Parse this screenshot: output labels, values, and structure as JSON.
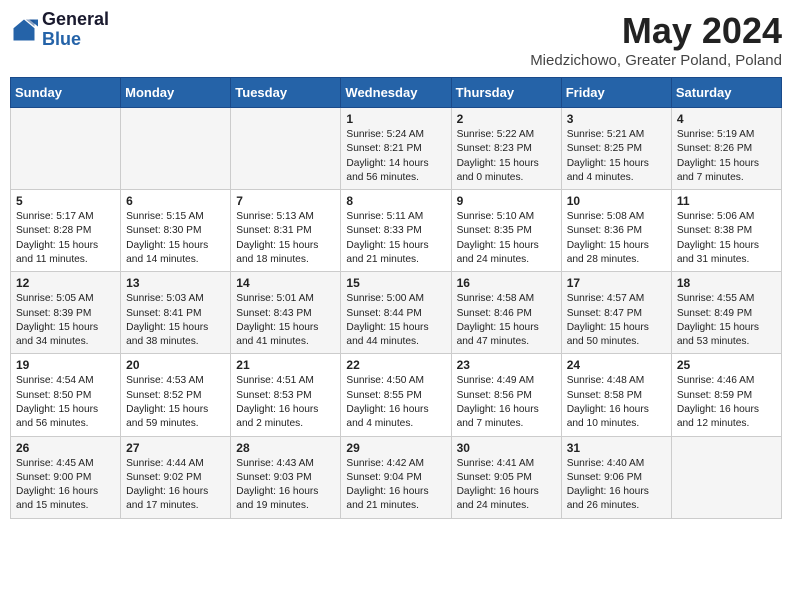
{
  "header": {
    "logo_general": "General",
    "logo_blue": "Blue",
    "title": "May 2024",
    "subtitle": "Miedzichowo, Greater Poland, Poland"
  },
  "weekdays": [
    "Sunday",
    "Monday",
    "Tuesday",
    "Wednesday",
    "Thursday",
    "Friday",
    "Saturday"
  ],
  "weeks": [
    [
      {
        "day": "",
        "info": ""
      },
      {
        "day": "",
        "info": ""
      },
      {
        "day": "",
        "info": ""
      },
      {
        "day": "1",
        "info": "Sunrise: 5:24 AM\nSunset: 8:21 PM\nDaylight: 14 hours\nand 56 minutes."
      },
      {
        "day": "2",
        "info": "Sunrise: 5:22 AM\nSunset: 8:23 PM\nDaylight: 15 hours\nand 0 minutes."
      },
      {
        "day": "3",
        "info": "Sunrise: 5:21 AM\nSunset: 8:25 PM\nDaylight: 15 hours\nand 4 minutes."
      },
      {
        "day": "4",
        "info": "Sunrise: 5:19 AM\nSunset: 8:26 PM\nDaylight: 15 hours\nand 7 minutes."
      }
    ],
    [
      {
        "day": "5",
        "info": "Sunrise: 5:17 AM\nSunset: 8:28 PM\nDaylight: 15 hours\nand 11 minutes."
      },
      {
        "day": "6",
        "info": "Sunrise: 5:15 AM\nSunset: 8:30 PM\nDaylight: 15 hours\nand 14 minutes."
      },
      {
        "day": "7",
        "info": "Sunrise: 5:13 AM\nSunset: 8:31 PM\nDaylight: 15 hours\nand 18 minutes."
      },
      {
        "day": "8",
        "info": "Sunrise: 5:11 AM\nSunset: 8:33 PM\nDaylight: 15 hours\nand 21 minutes."
      },
      {
        "day": "9",
        "info": "Sunrise: 5:10 AM\nSunset: 8:35 PM\nDaylight: 15 hours\nand 24 minutes."
      },
      {
        "day": "10",
        "info": "Sunrise: 5:08 AM\nSunset: 8:36 PM\nDaylight: 15 hours\nand 28 minutes."
      },
      {
        "day": "11",
        "info": "Sunrise: 5:06 AM\nSunset: 8:38 PM\nDaylight: 15 hours\nand 31 minutes."
      }
    ],
    [
      {
        "day": "12",
        "info": "Sunrise: 5:05 AM\nSunset: 8:39 PM\nDaylight: 15 hours\nand 34 minutes."
      },
      {
        "day": "13",
        "info": "Sunrise: 5:03 AM\nSunset: 8:41 PM\nDaylight: 15 hours\nand 38 minutes."
      },
      {
        "day": "14",
        "info": "Sunrise: 5:01 AM\nSunset: 8:43 PM\nDaylight: 15 hours\nand 41 minutes."
      },
      {
        "day": "15",
        "info": "Sunrise: 5:00 AM\nSunset: 8:44 PM\nDaylight: 15 hours\nand 44 minutes."
      },
      {
        "day": "16",
        "info": "Sunrise: 4:58 AM\nSunset: 8:46 PM\nDaylight: 15 hours\nand 47 minutes."
      },
      {
        "day": "17",
        "info": "Sunrise: 4:57 AM\nSunset: 8:47 PM\nDaylight: 15 hours\nand 50 minutes."
      },
      {
        "day": "18",
        "info": "Sunrise: 4:55 AM\nSunset: 8:49 PM\nDaylight: 15 hours\nand 53 minutes."
      }
    ],
    [
      {
        "day": "19",
        "info": "Sunrise: 4:54 AM\nSunset: 8:50 PM\nDaylight: 15 hours\nand 56 minutes."
      },
      {
        "day": "20",
        "info": "Sunrise: 4:53 AM\nSunset: 8:52 PM\nDaylight: 15 hours\nand 59 minutes."
      },
      {
        "day": "21",
        "info": "Sunrise: 4:51 AM\nSunset: 8:53 PM\nDaylight: 16 hours\nand 2 minutes."
      },
      {
        "day": "22",
        "info": "Sunrise: 4:50 AM\nSunset: 8:55 PM\nDaylight: 16 hours\nand 4 minutes."
      },
      {
        "day": "23",
        "info": "Sunrise: 4:49 AM\nSunset: 8:56 PM\nDaylight: 16 hours\nand 7 minutes."
      },
      {
        "day": "24",
        "info": "Sunrise: 4:48 AM\nSunset: 8:58 PM\nDaylight: 16 hours\nand 10 minutes."
      },
      {
        "day": "25",
        "info": "Sunrise: 4:46 AM\nSunset: 8:59 PM\nDaylight: 16 hours\nand 12 minutes."
      }
    ],
    [
      {
        "day": "26",
        "info": "Sunrise: 4:45 AM\nSunset: 9:00 PM\nDaylight: 16 hours\nand 15 minutes."
      },
      {
        "day": "27",
        "info": "Sunrise: 4:44 AM\nSunset: 9:02 PM\nDaylight: 16 hours\nand 17 minutes."
      },
      {
        "day": "28",
        "info": "Sunrise: 4:43 AM\nSunset: 9:03 PM\nDaylight: 16 hours\nand 19 minutes."
      },
      {
        "day": "29",
        "info": "Sunrise: 4:42 AM\nSunset: 9:04 PM\nDaylight: 16 hours\nand 21 minutes."
      },
      {
        "day": "30",
        "info": "Sunrise: 4:41 AM\nSunset: 9:05 PM\nDaylight: 16 hours\nand 24 minutes."
      },
      {
        "day": "31",
        "info": "Sunrise: 4:40 AM\nSunset: 9:06 PM\nDaylight: 16 hours\nand 26 minutes."
      },
      {
        "day": "",
        "info": ""
      }
    ]
  ]
}
